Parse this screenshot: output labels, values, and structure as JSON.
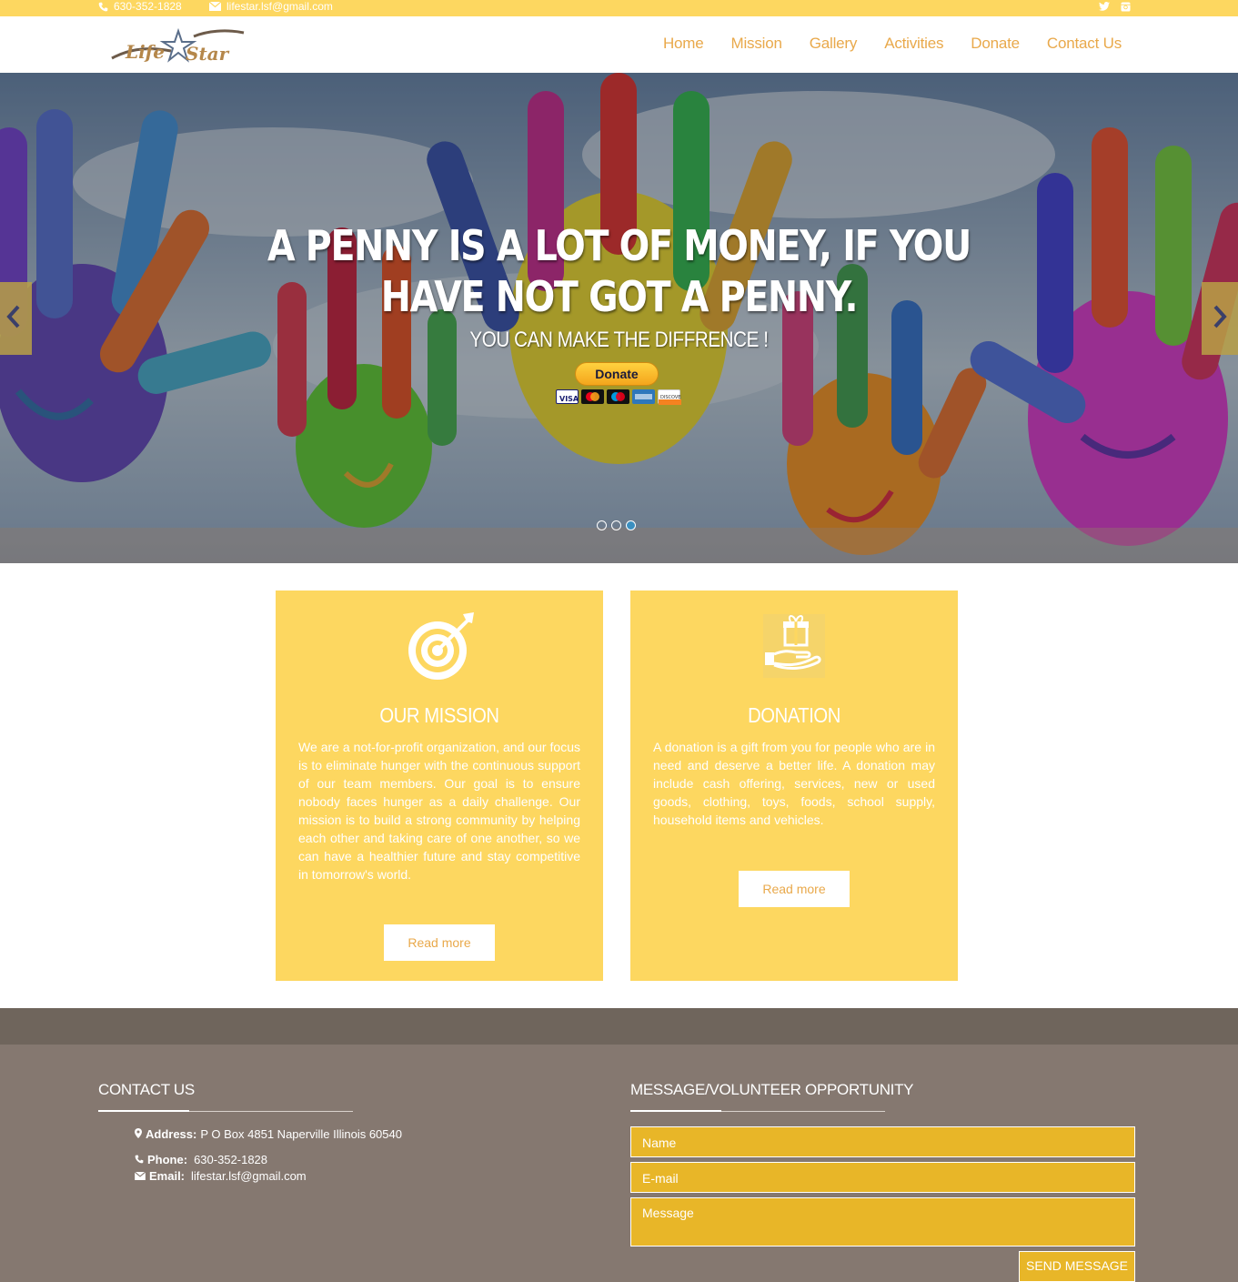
{
  "topbar": {
    "phone": "630-352-1828",
    "email": "lifestar.lsf@gmail.com",
    "social_icons": [
      "twitter-icon",
      "instagram-icon"
    ]
  },
  "header": {
    "logo_text_1": "Life",
    "logo_text_2": "Star",
    "nav": [
      "Home",
      "Mission",
      "Gallery",
      "Activities",
      "Donate",
      "Contact Us"
    ]
  },
  "hero": {
    "title_line1": "A PENNY IS A LOT OF MONEY, IF YOU",
    "title_line2": "HAVE NOT GOT A PENNY.",
    "subtitle": "YOU CAN MAKE THE DIFFRENCE !",
    "donate_label": "Donate",
    "card_labels": [
      "VISA",
      "MC",
      "Maestro",
      "AMEX",
      "DISCOVER"
    ],
    "slide_count": 3,
    "active_slide": 3
  },
  "mission": {
    "title": "OUR MISSION",
    "text": "We are a not-for-profit organization, and our focus is to eliminate hunger with the continuous support of our team members. Our goal is to ensure nobody faces hunger as a daily challenge. Our mission is to build a strong community by helping each other and taking care of one another, so we can have a healthier future and stay competitive in tomorrow's world.",
    "button": "Read more"
  },
  "donation": {
    "title": "DONATION",
    "text": "A donation is a gift from you for people who are in need and deserve a better life. A donation may include cash offering, services, new or used goods, clothing, toys, foods, school supply, household items and vehicles.",
    "button": "Read more"
  },
  "contact": {
    "heading": "CONTACT US",
    "address_label": "Address:",
    "address": "P O Box 4851 Naperville Illinois 60540",
    "phone_label": "Phone:",
    "phone": "630-352-1828",
    "email_label": "Email:",
    "email": "lifestar.lsf@gmail.com"
  },
  "message_form": {
    "heading": "MESSAGE/VOLUNTEER OPPORTUNITY",
    "name_placeholder": "Name",
    "email_placeholder": "E-mail",
    "message_placeholder": "Message",
    "send_label": "SEND MESSAGE"
  },
  "colors": {
    "accent_yellow": "#fdd760",
    "nav_orange": "#e9a94b",
    "footer_brown": "#857870",
    "field_gold": "#e8b628"
  }
}
